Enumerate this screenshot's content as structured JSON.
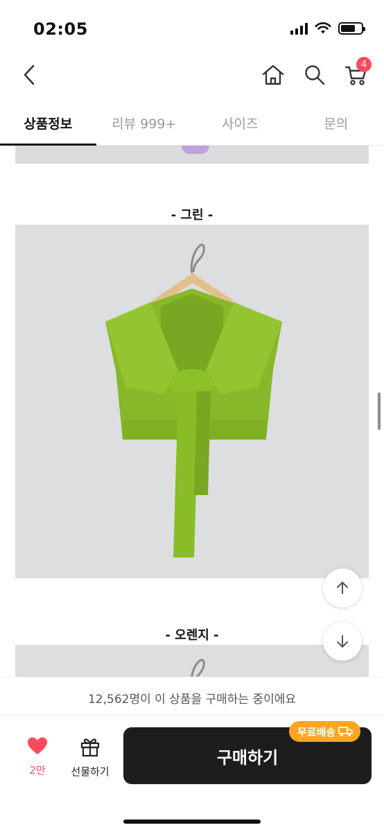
{
  "status": {
    "time": "02:05"
  },
  "header": {
    "cart_count": "4"
  },
  "tabs": [
    {
      "label": "상품정보",
      "active": true
    },
    {
      "label": "리뷰 999+",
      "active": false
    },
    {
      "label": "사이즈",
      "active": false
    },
    {
      "label": "문의",
      "active": false
    }
  ],
  "sections": [
    {
      "title": "- 그린 -",
      "color": "#8cc12a"
    },
    {
      "title": "- 오렌지 -"
    }
  ],
  "buyer_notice": "12,562명이 이 상품을 구매하는 중이에요",
  "actions": {
    "like_count": "2만",
    "gift_label": "선물하기",
    "buy_label": "구매하기",
    "shipping_badge": "무료배송"
  },
  "colors": {
    "accent_red": "#ff4a5e",
    "badge_orange": "#ffa51e",
    "buy_button": "#1d1d1d"
  }
}
